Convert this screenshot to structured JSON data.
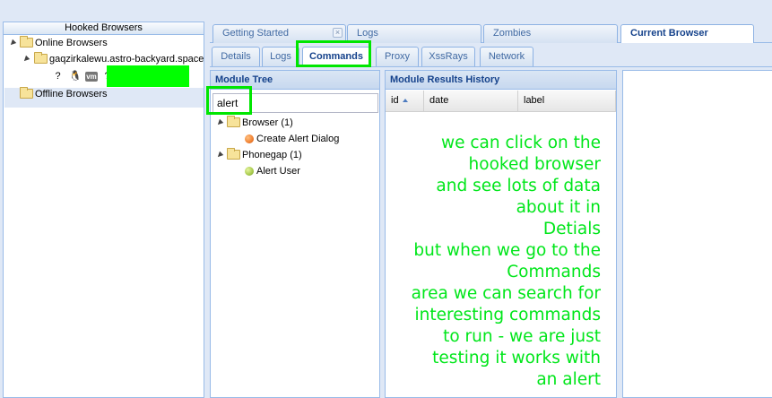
{
  "left_panel": {
    "title": "Hooked Browsers",
    "online_label": "Online Browsers",
    "host_label": "gaqzirkalewu.astro-backyard.space",
    "offline_label": "Offline Browsers",
    "host_icons": [
      "unknown-browser-icon",
      "linux-tux-icon",
      "vm-icon",
      "unknown-icon"
    ],
    "question_glyph": "?",
    "tux_glyph": "🐧",
    "vm_text": "vm"
  },
  "main_tabs": [
    {
      "label": "Getting Started",
      "close": "×"
    },
    {
      "label": "Logs"
    },
    {
      "label": "Zombies"
    },
    {
      "label": "Current Browser",
      "active": true
    }
  ],
  "sub_tabs": [
    {
      "label": "Details"
    },
    {
      "label": "Logs"
    },
    {
      "label": "Commands",
      "active": true
    },
    {
      "label": "Proxy"
    },
    {
      "label": "XssRays"
    },
    {
      "label": "Network"
    }
  ],
  "module_tree": {
    "title": "Module Tree",
    "search_value": "alert",
    "groups": [
      {
        "label": "Browser (1)",
        "items": [
          {
            "label": "Create Alert Dialog",
            "status_color": "#f08030"
          }
        ]
      },
      {
        "label": "Phonegap (1)",
        "items": [
          {
            "label": "Alert User",
            "status_color": "#a6c94a"
          }
        ]
      }
    ]
  },
  "results": {
    "title": "Module Results History",
    "columns": [
      "id",
      "date",
      "label"
    ],
    "sort_column": "id"
  },
  "annotation": "we can click on the\nhooked browser\nand see lots of data\nabout it in\nDetials\nbut when we go to the\nCommands\narea we can search for\ninteresting commands\nto run - we are just\ntesting it works with\nan alert",
  "colors": {
    "highlight": "#00e600",
    "redaction": "#00ff00",
    "annotation_text": "#00e61a"
  }
}
